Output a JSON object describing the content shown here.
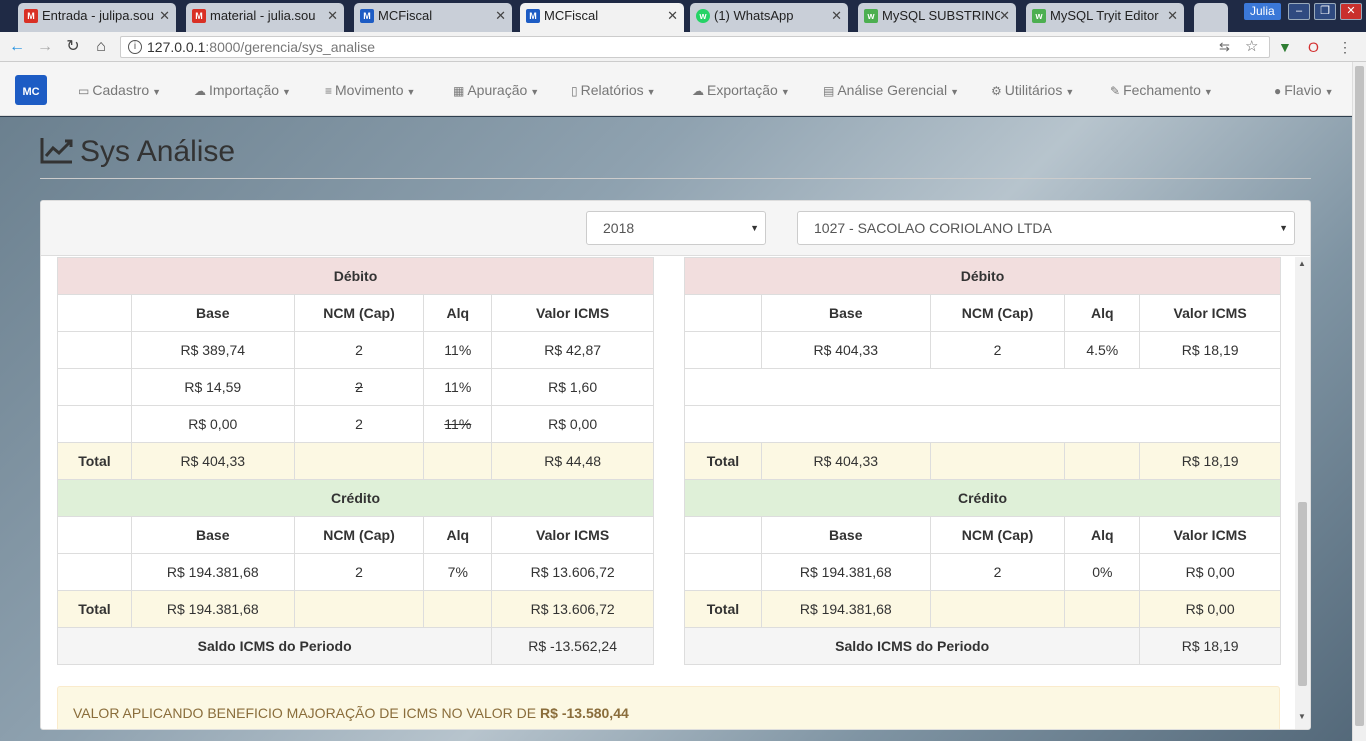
{
  "browser": {
    "tabs": [
      {
        "label": "Entrada - julipa.sou",
        "icon": "gmail-icon",
        "active": false
      },
      {
        "label": "material - julia.sou",
        "icon": "gmail-icon",
        "active": false
      },
      {
        "label": "MCFiscal",
        "icon": "mcfiscal-icon",
        "active": false
      },
      {
        "label": "MCFiscal",
        "icon": "mcfiscal-icon",
        "active": true
      },
      {
        "label": "(1) WhatsApp",
        "icon": "whatsapp-icon",
        "active": false
      },
      {
        "label": "MySQL SUBSTRING",
        "icon": "w3schools-icon",
        "active": false
      },
      {
        "label": "MySQL Tryit Editor",
        "icon": "w3schools-icon",
        "active": false
      }
    ],
    "user": "Julia",
    "url_host": "127.0.0.1",
    "url_path": ":8000/gerencia/sys_analise"
  },
  "navbar": {
    "logo": "MC",
    "menus": [
      "Cadastro",
      "Importação",
      "Movimento",
      "Apuração",
      "Relatórios",
      "Exportação",
      "Análise Gerencial",
      "Utilitários",
      "Fechamento",
      "Flavio"
    ]
  },
  "page": {
    "title": "Sys Análise"
  },
  "filters": {
    "year": "2018",
    "company": "1027 - SACOLAO CORIOLANO LTDA"
  },
  "labels": {
    "debito": "Débito",
    "credito": "Crédito",
    "base": "Base",
    "ncm": "NCM (Cap)",
    "alq": "Alq",
    "valor": "Valor ICMS",
    "total": "Total",
    "saldo": "Saldo ICMS do Periodo"
  },
  "left": {
    "debito_rows": [
      {
        "base": "R$ 389,74",
        "ncm": "2",
        "alq": "11%",
        "valor": "R$ 42,87"
      },
      {
        "base": "R$ 14,59",
        "ncm": "2",
        "alq": "11%",
        "valor": "R$ 1,60"
      },
      {
        "base": "R$ 0,00",
        "ncm": "2",
        "alq": "11%",
        "valor": "R$ 0,00"
      }
    ],
    "debito_total": {
      "base": "R$ 404,33",
      "valor": "R$ 44,48"
    },
    "credito_rows": [
      {
        "base": "R$ 194.381,68",
        "ncm": "2",
        "alq": "7%",
        "valor": "R$ 13.606,72"
      }
    ],
    "credito_total": {
      "base": "R$ 194.381,68",
      "valor": "R$ 13.606,72"
    },
    "saldo": "R$ -13.562,24"
  },
  "right": {
    "debito_rows": [
      {
        "base": "R$ 404,33",
        "ncm": "2",
        "alq": "4.5%",
        "valor": "R$ 18,19"
      }
    ],
    "debito_total": {
      "base": "R$ 404,33",
      "valor": "R$ 18,19"
    },
    "credito_rows": [
      {
        "base": "R$ 194.381,68",
        "ncm": "2",
        "alq": "0%",
        "valor": "R$ 0,00"
      }
    ],
    "credito_total": {
      "base": "R$ 194.381,68",
      "valor": "R$ 0,00"
    },
    "saldo": "R$ 18,19"
  },
  "alert": {
    "text": "VALOR APLICANDO BENEFICIO MAJORAÇÃO DE ICMS NO VALOR DE ",
    "value": "R$ -13.580,44"
  }
}
